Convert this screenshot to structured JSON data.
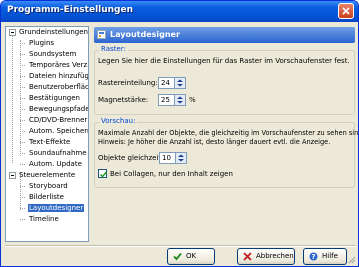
{
  "window": {
    "title": "Programm-Einstellungen"
  },
  "tree": {
    "groups": [
      {
        "label": "Grundeinstellungen",
        "items": [
          "Plugins",
          "Soundsystem",
          "Temporäres Verz...",
          "Dateien hinzufügen",
          "Benutzeroberfläche",
          "Bestätigungen",
          "Bewegungspfade",
          "CD/DVD-Brenner",
          "Autom. Speichern",
          "Text-Effekte",
          "Soundaufnahme",
          "Autom. Update"
        ]
      },
      {
        "label": "Steuerelemente",
        "items": [
          "Storyboard",
          "Bilderliste",
          "Layoutdesigner",
          "Timeline"
        ]
      }
    ],
    "selected": "Layoutdesigner"
  },
  "panel": {
    "title": "Layoutdesigner",
    "raster": {
      "label": "Raster:",
      "description": "Legen Sie hier die Einstellungen für das Raster im Vorschaufenster fest.",
      "rastereinteilung_label": "Rastereinteilung:",
      "rastereinteilung_value": "24",
      "magnetstaerke_label": "Magnetstärke:",
      "magnetstaerke_value": "25",
      "magnetstaerke_unit": "%"
    },
    "vorschau": {
      "label": "Vorschau:",
      "description_line1": "Maximale Anzahl der Objekte, die gleichzeitig im Vorschaufenster zu sehen sind.",
      "description_line2": "Hinweis: Je höher die Anzahl ist, desto länger dauert evtl. die Anzeige.",
      "objekte_label": "Objekte gleichzeitig:",
      "objekte_value": "10",
      "collagen_label": "Bei Collagen, nur den Inhalt zeigen",
      "collagen_checked": true
    }
  },
  "buttons": {
    "ok": "OK",
    "abbrechen": "Abbrechen",
    "hilfe": "Hilfe"
  },
  "colors": {
    "titlebar": "#0453d6",
    "header": "#2b64cf",
    "selection": "#316ac5",
    "group_label": "#0046d5"
  }
}
